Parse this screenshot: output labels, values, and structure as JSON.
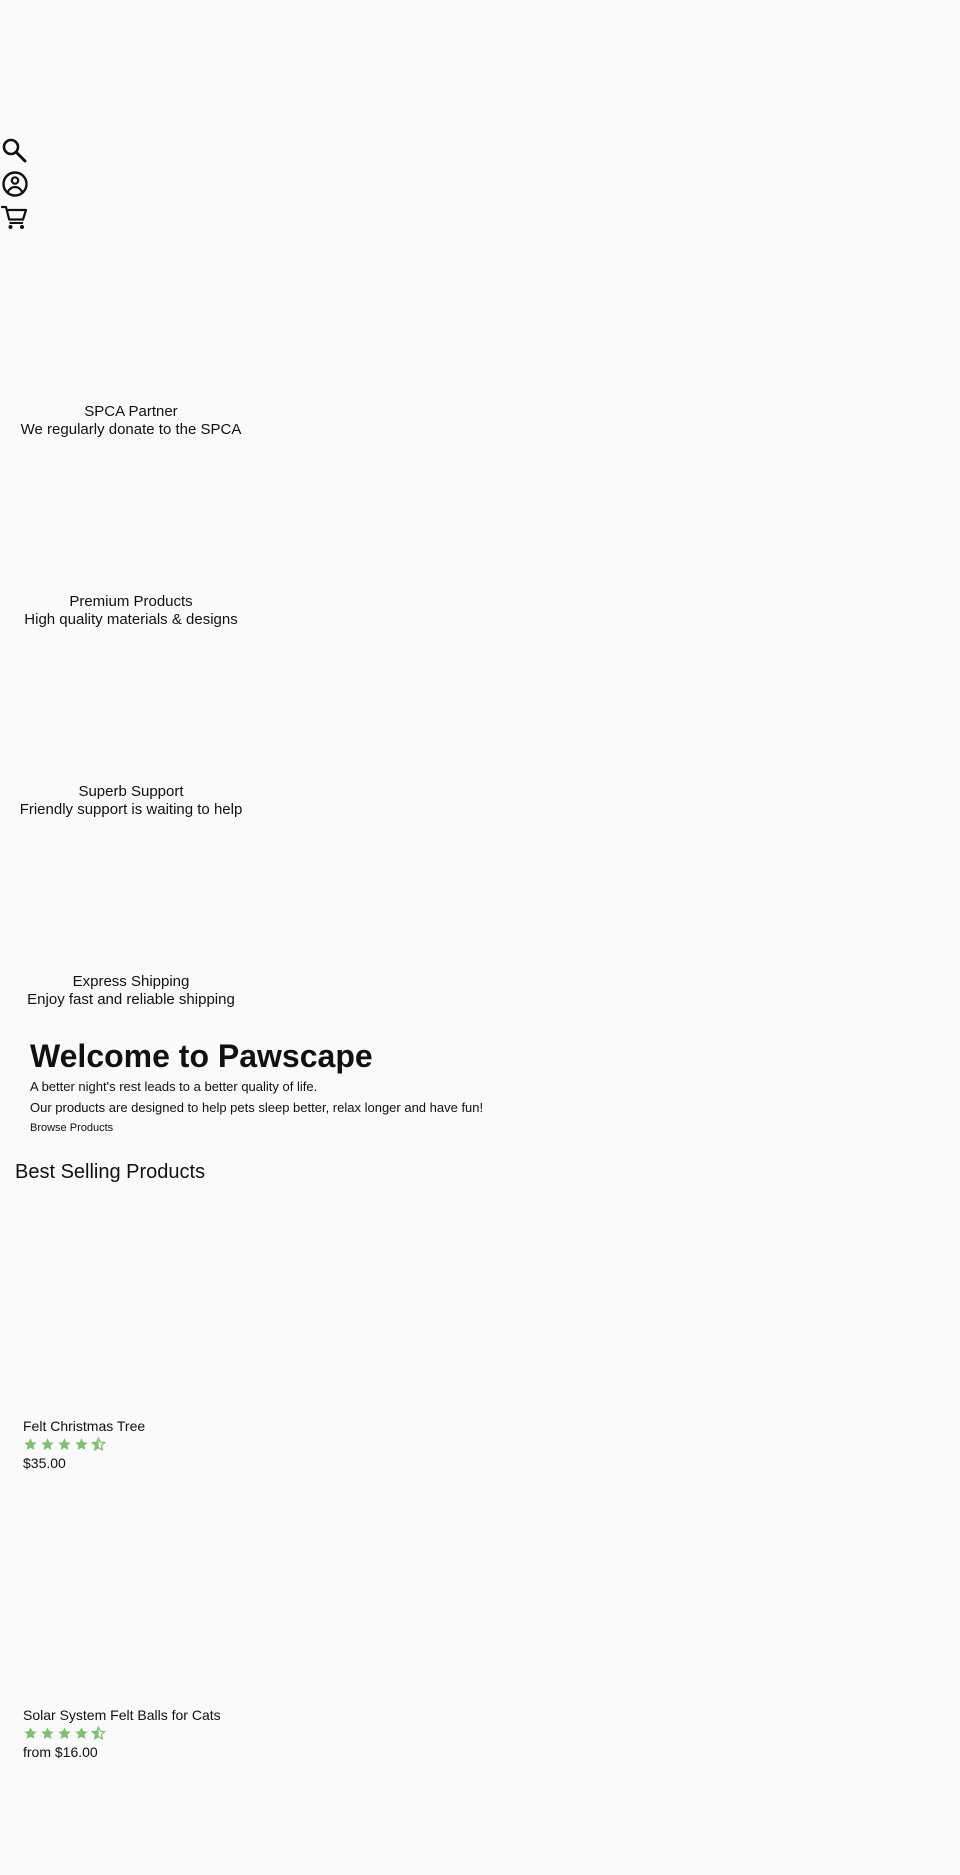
{
  "header": {
    "icons": [
      "search-icon",
      "account-icon",
      "cart-icon"
    ]
  },
  "features": [
    {
      "title": "SPCA Partner",
      "subtitle": "We regularly donate to the SPCA"
    },
    {
      "title": "Premium Products",
      "subtitle": "High quality materials & designs"
    },
    {
      "title": "Superb Support",
      "subtitle": "Friendly support is waiting to help"
    },
    {
      "title": "Express Shipping",
      "subtitle": "Enjoy fast and reliable shipping"
    }
  ],
  "welcome": {
    "heading": "Welcome to Pawscape",
    "line1": "A better night's rest leads to a better quality of life.",
    "line2": "Our products are designed to help pets sleep better, relax longer and have fun!",
    "cta": "Browse Products"
  },
  "best_selling": {
    "heading": "Best Selling Products",
    "products": [
      {
        "title": "Felt Christmas Tree",
        "rating": 4.5,
        "max_rating": 5,
        "price": "$35.00"
      },
      {
        "title": "Solar System Felt Balls for Cats",
        "rating": 4.5,
        "max_rating": 5,
        "price": "from $16.00"
      }
    ]
  },
  "colors": {
    "background": "#fafafa",
    "text": "#111111",
    "star": "#7ec06f"
  }
}
